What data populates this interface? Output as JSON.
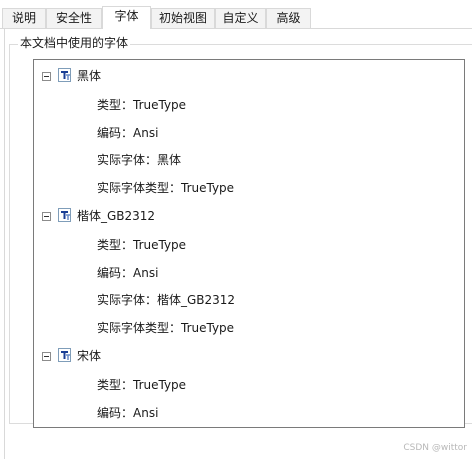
{
  "tabs": [
    {
      "label": "说明"
    },
    {
      "label": "安全性"
    },
    {
      "label": "字体",
      "active": true
    },
    {
      "label": "初始视图"
    },
    {
      "label": "自定义"
    },
    {
      "label": "高级"
    }
  ],
  "group": {
    "title": "本文档中使用的字体"
  },
  "fonts": [
    {
      "name": "黑体",
      "props": [
        "类型：TrueType",
        "编码：Ansi",
        "实际字体：黑体",
        "实际字体类型：TrueType"
      ]
    },
    {
      "name": "楷体_GB2312",
      "props": [
        "类型：TrueType",
        "编码：Ansi",
        "实际字体：楷体_GB2312",
        "实际字体类型：TrueType"
      ]
    },
    {
      "name": "宋体",
      "props": [
        "类型：TrueType",
        "编码：Ansi"
      ]
    }
  ],
  "icons": {
    "expander": "collapse-minus-icon",
    "font": "truetype-font-icon"
  },
  "watermark": "CSDN @wittor"
}
